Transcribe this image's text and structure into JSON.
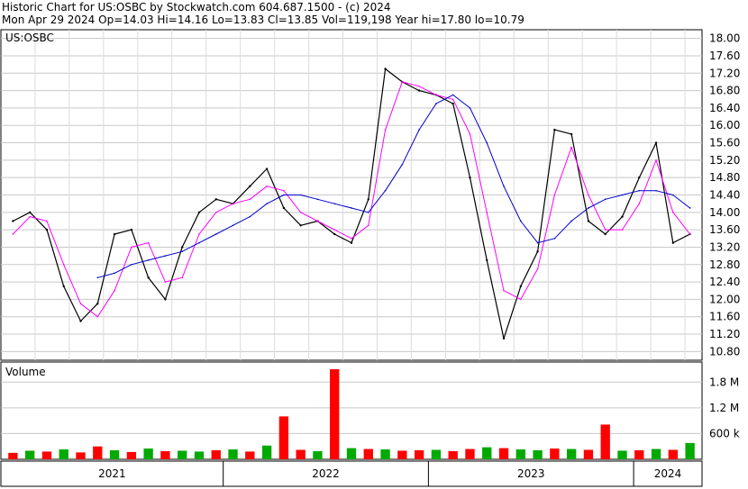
{
  "header": {
    "line1": "Historic Chart for US:OSBC by Stockwatch.com 604.687.1500 - (c) 2024",
    "line2": "Mon Apr 29 2024  Op=14.03  Hi=14.16  Lo=13.83  Cl=13.85  Vol=119,198  Year hi=17.80  lo=10.79"
  },
  "chart_data": [
    {
      "type": "line",
      "panel": "price",
      "label": "US:OSBC",
      "y_ticks": [
        "18.00",
        "17.60",
        "17.20",
        "16.80",
        "16.40",
        "16.00",
        "15.60",
        "15.20",
        "14.80",
        "14.40",
        "14.00",
        "13.60",
        "13.20",
        "12.80",
        "12.40",
        "12.00",
        "11.60",
        "11.20",
        "10.80"
      ],
      "ylim": [
        10.6,
        18.2
      ],
      "x": [
        "2020-12",
        "2021-01",
        "2021-02",
        "2021-03",
        "2021-04",
        "2021-05",
        "2021-06",
        "2021-07",
        "2021-08",
        "2021-09",
        "2021-10",
        "2021-11",
        "2021-12",
        "2022-01",
        "2022-02",
        "2022-03",
        "2022-04",
        "2022-05",
        "2022-06",
        "2022-07",
        "2022-08",
        "2022-09",
        "2022-10",
        "2022-11",
        "2022-12",
        "2023-01",
        "2023-02",
        "2023-03",
        "2023-04",
        "2023-05",
        "2023-06",
        "2023-07",
        "2023-08",
        "2023-09",
        "2023-10",
        "2023-11",
        "2023-12",
        "2024-01",
        "2024-02",
        "2024-03",
        "2024-04"
      ],
      "series": [
        {
          "color": "#000000",
          "values": [
            13.8,
            14.0,
            13.6,
            12.3,
            11.5,
            11.9,
            13.5,
            13.6,
            12.5,
            12.0,
            13.2,
            14.0,
            14.3,
            14.2,
            14.6,
            15.0,
            14.1,
            13.7,
            13.8,
            13.5,
            13.3,
            14.3,
            17.3,
            17.0,
            16.8,
            16.7,
            16.5,
            14.8,
            12.9,
            11.1,
            12.3,
            13.1,
            15.9,
            15.8,
            13.8,
            13.5,
            13.9,
            14.8,
            15.6,
            13.3,
            13.5
          ]
        },
        {
          "color": "#ff00ff",
          "values": [
            13.5,
            13.9,
            13.8,
            12.8,
            11.9,
            11.6,
            12.2,
            13.2,
            13.3,
            12.4,
            12.5,
            13.5,
            14.0,
            14.2,
            14.3,
            14.6,
            14.5,
            14.0,
            13.8,
            13.6,
            13.4,
            13.7,
            15.9,
            17.0,
            16.9,
            16.7,
            16.6,
            15.8,
            14.0,
            12.2,
            12.0,
            12.7,
            14.4,
            15.5,
            14.4,
            13.6,
            13.6,
            14.2,
            15.2,
            14.0,
            13.5
          ]
        },
        {
          "color": "#0000cc",
          "values": [
            null,
            null,
            null,
            null,
            null,
            12.5,
            12.6,
            12.8,
            12.9,
            13.0,
            13.1,
            13.3,
            13.5,
            13.7,
            13.9,
            14.2,
            14.4,
            14.4,
            14.3,
            14.2,
            14.1,
            14.0,
            14.5,
            15.1,
            15.9,
            16.5,
            16.7,
            16.4,
            15.6,
            14.6,
            13.8,
            13.3,
            13.4,
            13.8,
            14.1,
            14.3,
            14.4,
            14.5,
            14.5,
            14.4,
            14.1
          ]
        }
      ]
    },
    {
      "type": "bar",
      "panel": "volume",
      "label": "Volume",
      "y_ticks": [
        "1.8 M",
        "1.2 M",
        "600 k"
      ],
      "ylim": [
        0,
        2100000
      ],
      "categories": [
        "2020-12",
        "2021-01",
        "2021-02",
        "2021-03",
        "2021-04",
        "2021-05",
        "2021-06",
        "2021-07",
        "2021-08",
        "2021-09",
        "2021-10",
        "2021-11",
        "2021-12",
        "2022-01",
        "2022-02",
        "2022-03",
        "2022-04",
        "2022-05",
        "2022-06",
        "2022-07",
        "2022-08",
        "2022-09",
        "2022-10",
        "2022-11",
        "2022-12",
        "2023-01",
        "2023-02",
        "2023-03",
        "2023-04",
        "2023-05",
        "2023-06",
        "2023-07",
        "2023-08",
        "2023-09",
        "2023-10",
        "2023-11",
        "2023-12",
        "2024-01",
        "2024-02",
        "2024-03",
        "2024-04"
      ],
      "values": [
        150000,
        200000,
        180000,
        230000,
        160000,
        300000,
        210000,
        170000,
        250000,
        190000,
        200000,
        180000,
        210000,
        230000,
        180000,
        320000,
        1000000,
        220000,
        190000,
        2100000,
        260000,
        240000,
        230000,
        200000,
        210000,
        220000,
        190000,
        240000,
        280000,
        260000,
        230000,
        210000,
        250000,
        240000,
        220000,
        810000,
        200000,
        210000,
        240000,
        220000,
        380000
      ],
      "colors": [
        "#ff0000",
        "#00aa00",
        "#ff0000",
        "#00aa00",
        "#ff0000",
        "#ff0000",
        "#00aa00",
        "#ff0000",
        "#00aa00",
        "#ff0000",
        "#00aa00",
        "#00aa00",
        "#ff0000",
        "#00aa00",
        "#ff0000",
        "#00aa00",
        "#ff0000",
        "#ff0000",
        "#00aa00",
        "#ff0000",
        "#00aa00",
        "#ff0000",
        "#00aa00",
        "#ff0000",
        "#ff0000",
        "#00aa00",
        "#ff0000",
        "#ff0000",
        "#00aa00",
        "#ff0000",
        "#00aa00",
        "#00aa00",
        "#ff0000",
        "#00aa00",
        "#ff0000",
        "#ff0000",
        "#00aa00",
        "#ff0000",
        "#00aa00",
        "#ff0000",
        "#00aa00"
      ]
    }
  ],
  "x_axis": {
    "labels": [
      "2021",
      "2022",
      "2023",
      "2024"
    ],
    "dividers": [
      "2021-01",
      "2022-01",
      "2023-01",
      "2024-01"
    ],
    "range": [
      "2020-12",
      "2024-04"
    ]
  }
}
